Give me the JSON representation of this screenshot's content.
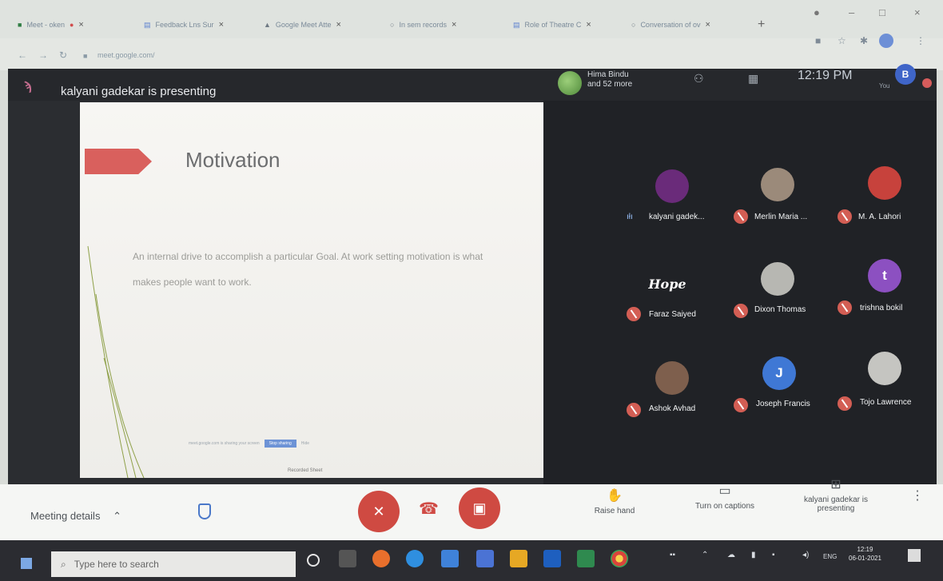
{
  "browser": {
    "tabs": [
      {
        "label": "Meet - oken"
      },
      {
        "label": "Feedback Lns Sur"
      },
      {
        "label": "Google Meet Atte"
      },
      {
        "label": "In sem records"
      },
      {
        "label": "Role of Theatre C"
      },
      {
        "label": "Conversation of ov"
      }
    ],
    "new_tab": "+",
    "url": "meet.google.com/"
  },
  "meeting": {
    "presenting_label": "kalyani gadekar is presenting",
    "participants_preview": {
      "line1": "Hima Bindu",
      "line2": "and 52 more"
    },
    "time": "12:19 PM",
    "you_label": "You",
    "my_initial": "B"
  },
  "slide": {
    "title": "Motivation",
    "body": "An internal drive to accomplish a particular Goal. At work setting motivation is what makes people want to work.",
    "footer": "Recorded Sheet",
    "share_text": "meet.google.com is sharing your screen",
    "stop_button": "Stop sharing",
    "hide_link": "Hide"
  },
  "participants": [
    {
      "name": "kalyani gadek...",
      "avatar": "",
      "avatar_color": "#6a2b7a",
      "speaking": true
    },
    {
      "name": "Merlin Maria ...",
      "avatar": "",
      "avatar_color": "#9b8a7a",
      "speaking": false
    },
    {
      "name": "M. A. Lahori",
      "avatar": "",
      "avatar_color": "#c7423c",
      "speaking": false
    },
    {
      "name": "Faraz Saiyed",
      "avatar": "Hope",
      "avatar_color": "#202226",
      "speaking": false
    },
    {
      "name": "Dixon Thomas",
      "avatar": "",
      "avatar_color": "#b7b7b2",
      "speaking": false
    },
    {
      "name": "trishna bokil",
      "avatar": "t",
      "avatar_color": "#8c50c1",
      "speaking": false
    },
    {
      "name": "Ashok Avhad",
      "avatar": "",
      "avatar_color": "#7e5f4d",
      "speaking": false
    },
    {
      "name": "Joseph Francis",
      "avatar": "J",
      "avatar_color": "#3f78d5",
      "speaking": false
    },
    {
      "name": "Tojo Lawrence",
      "avatar": "",
      "avatar_color": "#c5c5c1",
      "speaking": false
    }
  ],
  "controls": {
    "meeting_details": "Meeting details",
    "raise_hand": "Raise hand",
    "captions": "Turn on captions",
    "presenting": "kalyani gadekar is presenting"
  },
  "taskbar": {
    "search_placeholder": "Type here to search",
    "lang": "ENG",
    "time": "12:19",
    "date": "06-01-2021"
  },
  "colors": {
    "meet_bg": "#202226",
    "accent_red": "#cf4a42",
    "slide_arrow": "#d9605d",
    "presenter_blue": "#3f65c8"
  }
}
